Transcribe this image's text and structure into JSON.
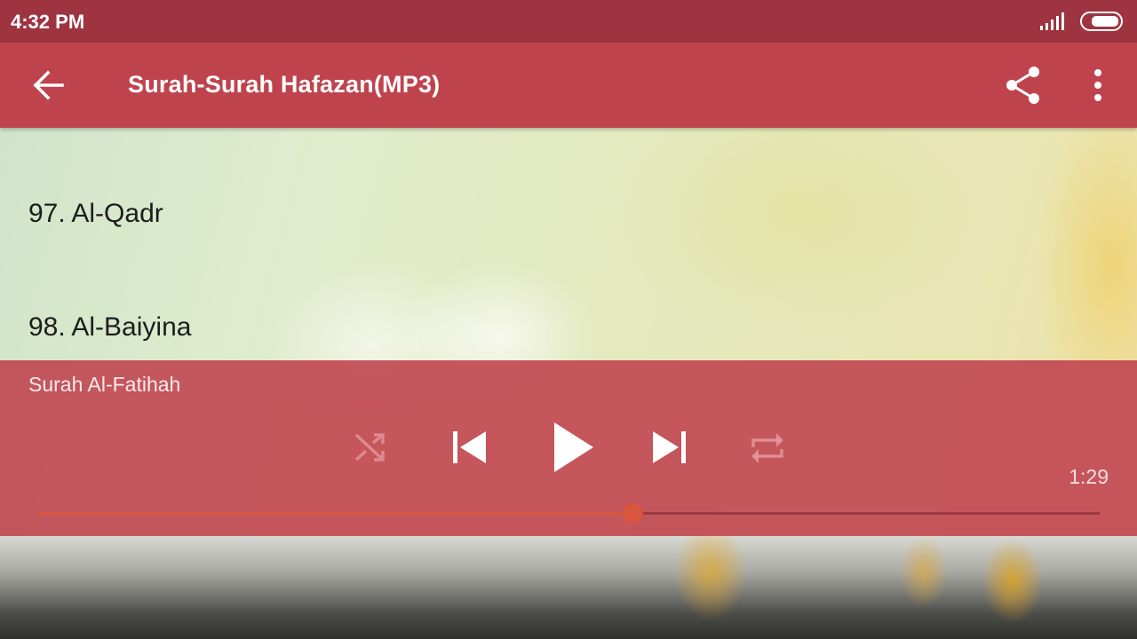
{
  "status_bar": {
    "time": "4:32 PM"
  },
  "app_bar": {
    "title": "Surah-Surah Hafazan(MP3)"
  },
  "list": {
    "items": [
      {
        "label": "97. Al-Qadr"
      },
      {
        "label": "98. Al-Baiyina"
      }
    ]
  },
  "player": {
    "now_playing": "Surah Al-Fatihah",
    "time": "1:29",
    "progress": 0.56,
    "controls": [
      "shuffle-icon",
      "previous-icon",
      "play-icon",
      "next-icon",
      "repeat-icon"
    ]
  },
  "colors": {
    "status_bar": "#9e3440",
    "app_bar": "#bf434d",
    "player_panel": "#c24a54",
    "seek_accent": "#d8553e"
  }
}
